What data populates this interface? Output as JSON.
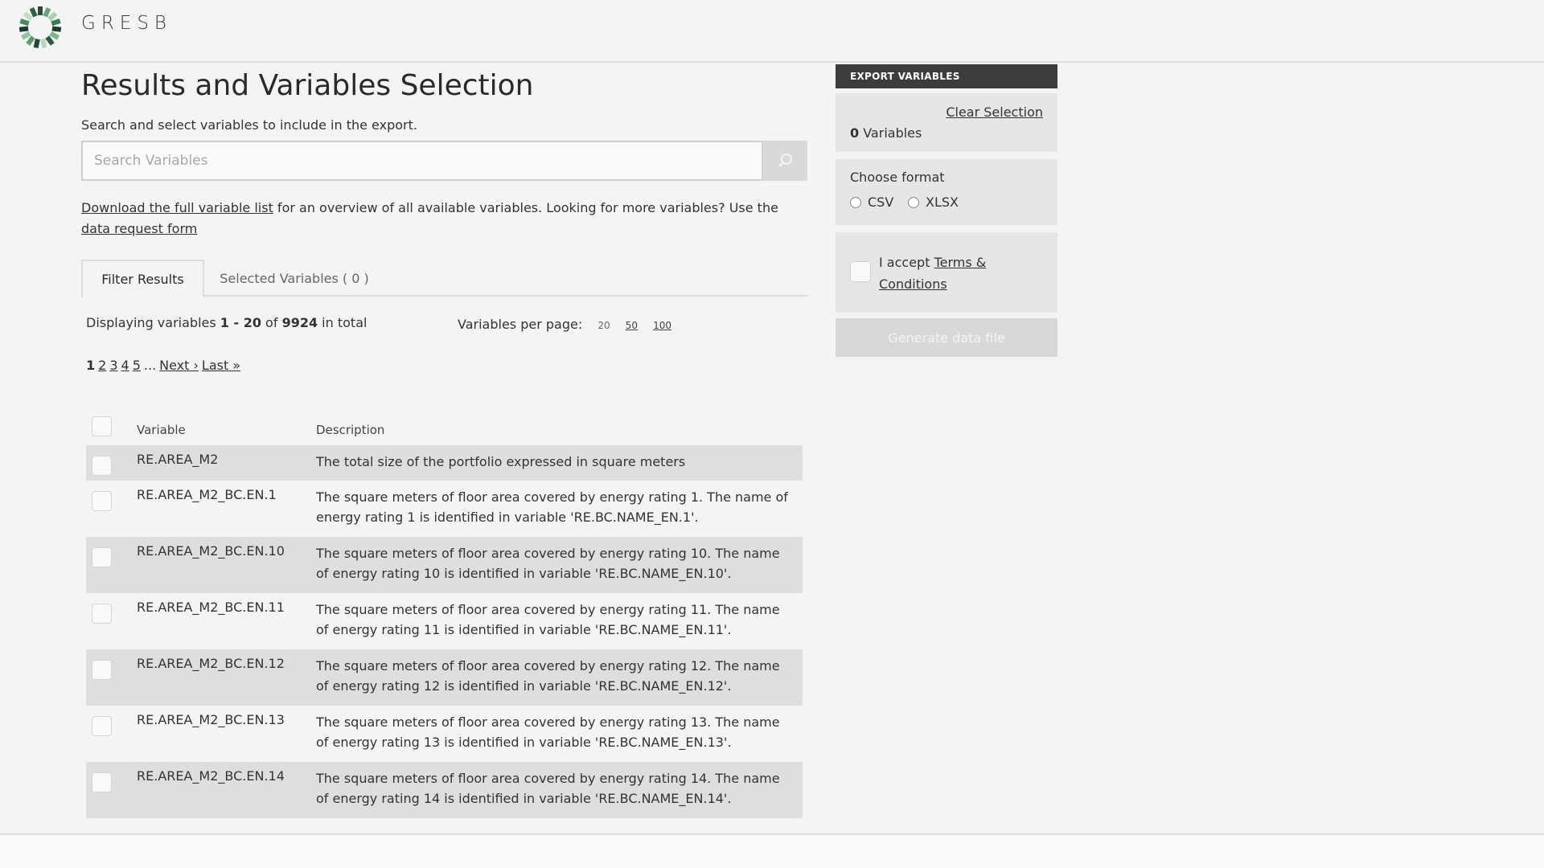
{
  "header": {
    "brand": "GRESB"
  },
  "main": {
    "title": "Results and Variables Selection",
    "subtitle": "Search and select variables to include in the export.",
    "search": {
      "placeholder": "Search Variables",
      "value": ""
    },
    "info": {
      "link1": "Download the full variable list",
      "text1": " for an overview of all available variables. Looking for more variables? Use the ",
      "link2": "data request form"
    },
    "tabs": [
      {
        "label": "Filter Results",
        "active": true
      },
      {
        "label": "Selected Variables ( 0 )",
        "active": false
      }
    ],
    "display": {
      "prefix": "Displaying variables ",
      "range": "1 - 20",
      "of": " of ",
      "total": "9924",
      "suffix": " in total"
    },
    "per_page": {
      "label": "Variables per page:",
      "options": [
        "20",
        "50",
        "100"
      ]
    },
    "pager": {
      "pages": [
        "1",
        "2",
        "3",
        "4",
        "5"
      ],
      "ellipsis": "...",
      "next": "Next ›",
      "last": "Last »"
    },
    "table": {
      "headers": {
        "variable": "Variable",
        "description": "Description"
      },
      "rows": [
        {
          "variable": "RE.AREA_M2",
          "description": "The total size of the portfolio expressed in square meters"
        },
        {
          "variable": "RE.AREA_M2_BC.EN.1",
          "description": "The square meters of floor area covered by energy rating 1. The name of energy rating 1 is identified in variable 'RE.BC.NAME_EN.1'."
        },
        {
          "variable": "RE.AREA_M2_BC.EN.10",
          "description": "The square meters of floor area covered by energy rating 10. The name of energy rating 10 is identified in variable 'RE.BC.NAME_EN.10'."
        },
        {
          "variable": "RE.AREA_M2_BC.EN.11",
          "description": "The square meters of floor area covered by energy rating 11. The name of energy rating 11 is identified in variable 'RE.BC.NAME_EN.11'."
        },
        {
          "variable": "RE.AREA_M2_BC.EN.12",
          "description": "The square meters of floor area covered by energy rating 12. The name of energy rating 12 is identified in variable 'RE.BC.NAME_EN.12'."
        },
        {
          "variable": "RE.AREA_M2_BC.EN.13",
          "description": "The square meters of floor area covered by energy rating 13. The name of energy rating 13 is identified in variable 'RE.BC.NAME_EN.13'."
        },
        {
          "variable": "RE.AREA_M2_BC.EN.14",
          "description": "The square meters of floor area covered by energy rating 14. The name of energy rating 14 is identified in variable 'RE.BC.NAME_EN.14'."
        }
      ]
    }
  },
  "sidebar": {
    "header": "EXPORT VARIABLES",
    "clear": "Clear Selection",
    "count": "0",
    "count_label": " Variables",
    "format_label": "Choose format",
    "formats": [
      "CSV",
      "XLSX"
    ],
    "terms_prefix": "I accept ",
    "terms_link": "Terms & Conditions",
    "generate": "Generate data file"
  }
}
